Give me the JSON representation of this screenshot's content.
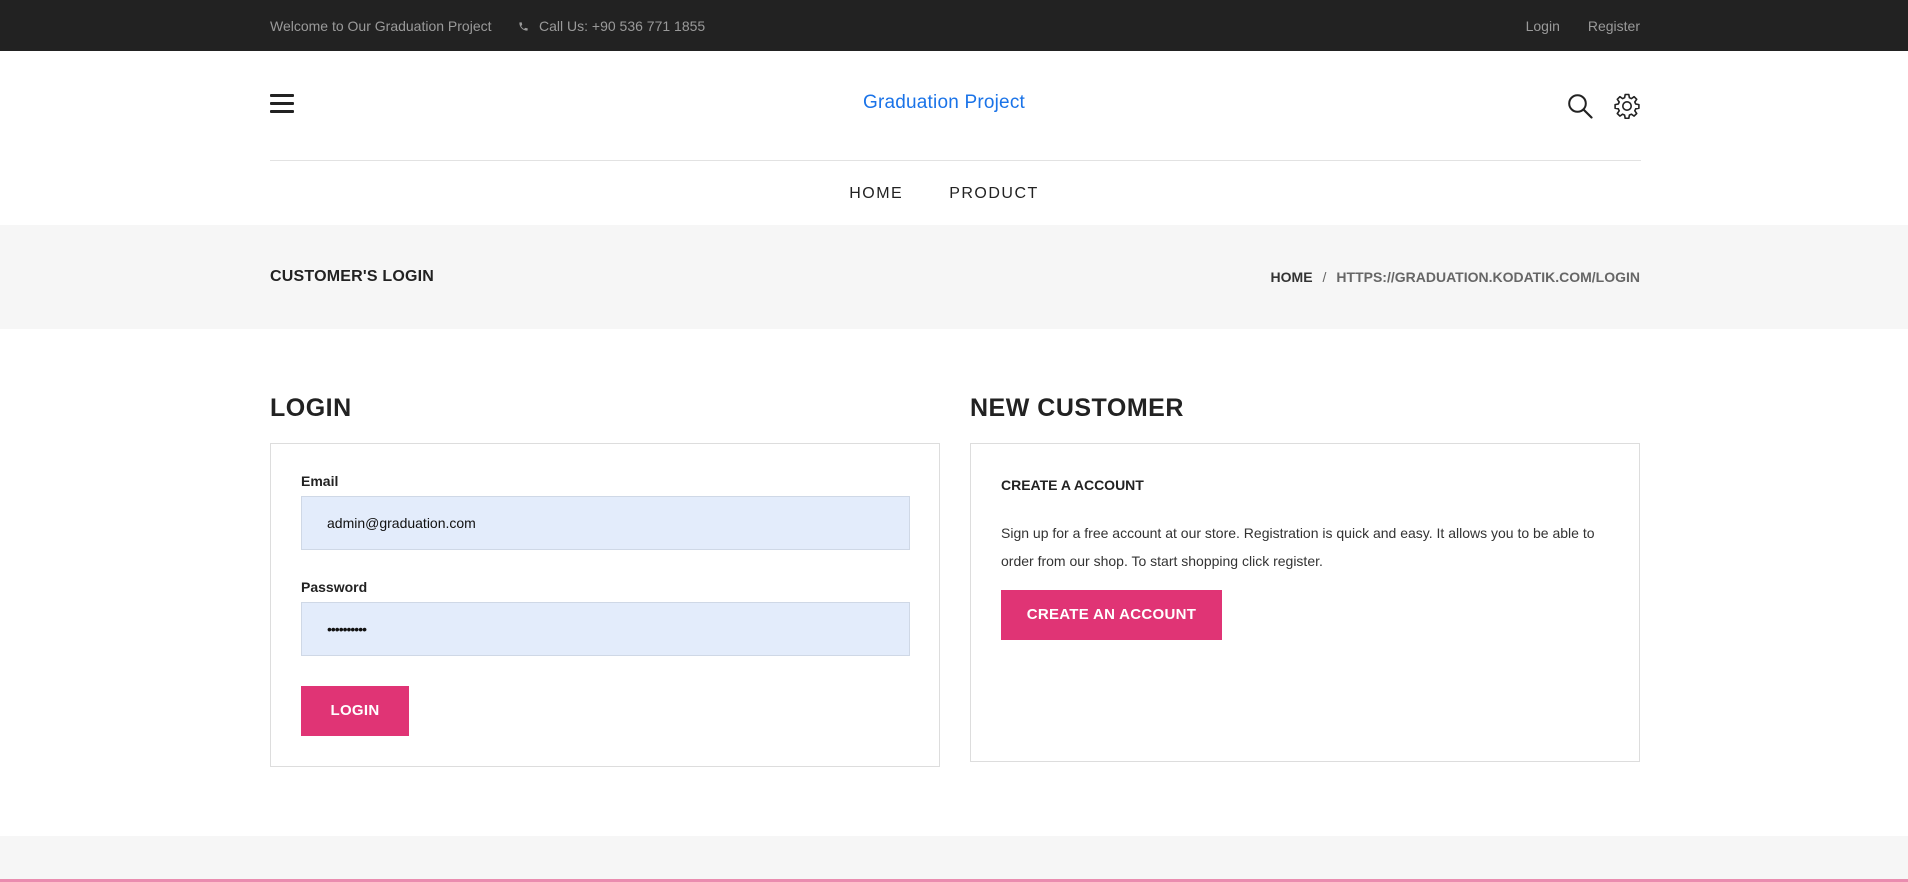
{
  "topbar": {
    "welcome": "Welcome to Our Graduation Project",
    "phone": "Call Us: +90 536 771 1855",
    "login": "Login",
    "register": "Register"
  },
  "header": {
    "brand": "Graduation Project"
  },
  "nav": {
    "items": [
      "HOME",
      "PRODUCT"
    ]
  },
  "breadcrumb": {
    "page_title": "CUSTOMER'S LOGIN",
    "home": "HOME",
    "separator": "/",
    "current": "HTTPS://GRADUATION.KODATIK.COM/LOGIN"
  },
  "login": {
    "title": "LOGIN",
    "email_label": "Email",
    "email_value": "admin@graduation.com",
    "password_label": "Password",
    "password_value": "••••••••••",
    "button": "LOGIN"
  },
  "new_customer": {
    "title": "NEW CUSTOMER",
    "heading": "CREATE A ACCOUNT",
    "text": "Sign up for a free account at our store. Registration is quick and easy. It allows you to be able to order from our shop. To start shopping click register.",
    "button": "CREATE AN ACCOUNT"
  },
  "colors": {
    "accent": "#e03475",
    "brand": "#1a73e8",
    "topbar": "#222222"
  },
  "icons": {
    "phone": "phone-icon",
    "menu": "hamburger-icon",
    "search": "search-icon",
    "settings": "gear-icon"
  }
}
